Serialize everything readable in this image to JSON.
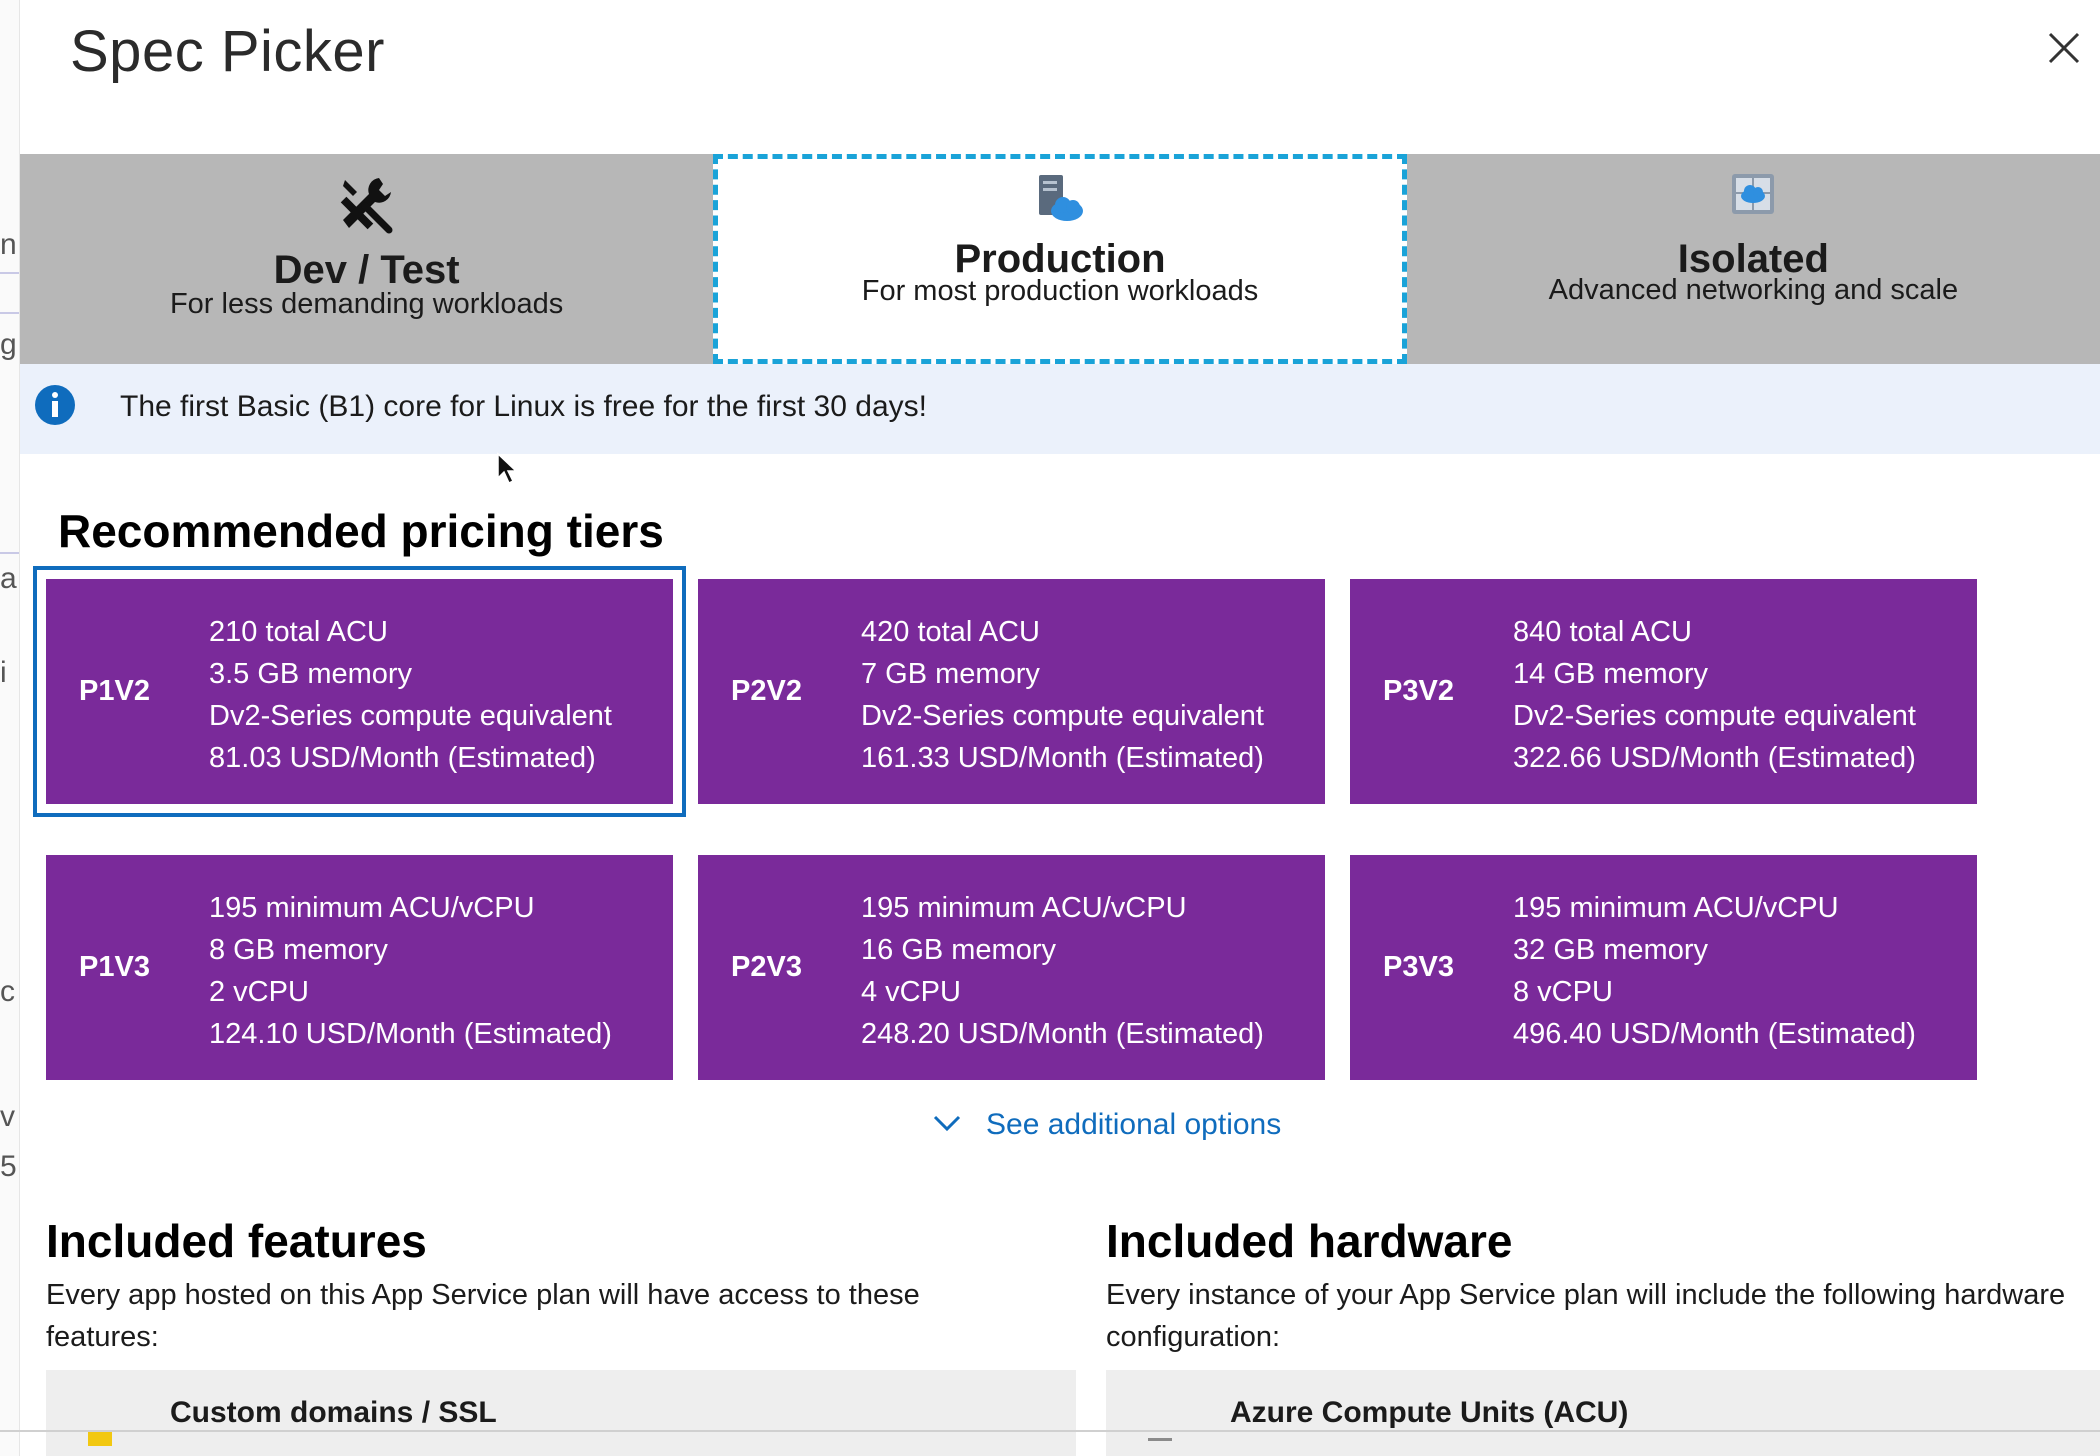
{
  "dialog": {
    "title": "Spec Picker",
    "close_label": "Close"
  },
  "categories": [
    {
      "name": "Dev / Test",
      "description": "For less demanding workloads",
      "icon": "tools-icon",
      "selected": false
    },
    {
      "name": "Production",
      "description": "For most production workloads",
      "icon": "server-cloud-icon",
      "selected": true
    },
    {
      "name": "Isolated",
      "description": "Advanced networking and scale",
      "icon": "isolated-cloud-icon",
      "selected": false
    }
  ],
  "banner": {
    "icon": "info-icon",
    "message": "The first Basic (B1) core for Linux is free for the first 30 days!"
  },
  "recommended": {
    "heading": "Recommended pricing tiers",
    "tiers": [
      {
        "name": "P1V2",
        "lines": [
          "210 total ACU",
          "3.5 GB memory",
          "Dv2-Series compute equivalent",
          "81.03 USD/Month (Estimated)"
        ],
        "selected": true
      },
      {
        "name": "P2V2",
        "lines": [
          "420 total ACU",
          "7 GB memory",
          "Dv2-Series compute equivalent",
          "161.33 USD/Month (Estimated)"
        ],
        "selected": false
      },
      {
        "name": "P3V2",
        "lines": [
          "840 total ACU",
          "14 GB memory",
          "Dv2-Series compute equivalent",
          "322.66 USD/Month (Estimated)"
        ],
        "selected": false
      },
      {
        "name": "P1V3",
        "lines": [
          "195 minimum ACU/vCPU",
          "8 GB memory",
          "2 vCPU",
          "124.10 USD/Month (Estimated)"
        ],
        "selected": false
      },
      {
        "name": "P2V3",
        "lines": [
          "195 minimum ACU/vCPU",
          "16 GB memory",
          "4 vCPU",
          "248.20 USD/Month (Estimated)"
        ],
        "selected": false
      },
      {
        "name": "P3V3",
        "lines": [
          "195 minimum ACU/vCPU",
          "32 GB memory",
          "8 vCPU",
          "496.40 USD/Month (Estimated)"
        ],
        "selected": false
      }
    ],
    "more_label": "See additional options"
  },
  "features": {
    "heading": "Included features",
    "description": "Every app hosted on this App Service plan will have access to these features:",
    "first_item": "Custom domains / SSL"
  },
  "hardware": {
    "heading": "Included hardware",
    "description": "Every instance of your App Service plan will include the following hardware configuration:",
    "first_item": "Azure Compute Units (ACU)"
  },
  "colors": {
    "tier_card": "#7a2a9a",
    "selected_outline": "#0f6cbd",
    "tab_bar": "#b7b7b7",
    "tab_selected_border": "#1aa3d8",
    "banner_bg": "#ebf1fb",
    "link": "#0f6cbd"
  }
}
